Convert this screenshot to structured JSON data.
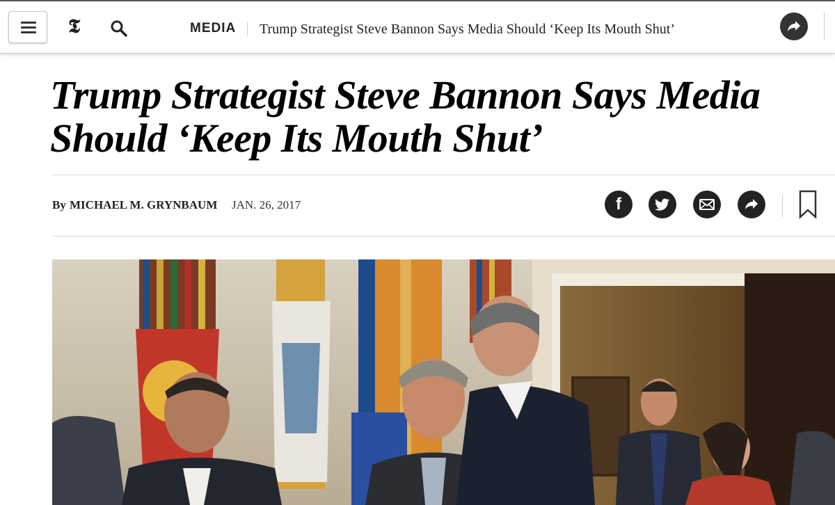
{
  "header": {
    "logo": "𝕿",
    "section": "MEDIA",
    "headline": "Trump Strategist Steve Bannon Says Media Should ‘Keep Its Mouth Shut’",
    "icons": [
      "menu-icon",
      "search-icon",
      "share-arrow-icon"
    ]
  },
  "article": {
    "headline_line1": "Trump Strategist Steve Bannon Says Media",
    "headline_line2": "Should ‘Keep Its Mouth Shut’",
    "byline_prefix": "By",
    "author": "MICHAEL M. GRYNBAUM",
    "date": "JAN. 26, 2017"
  },
  "share_buttons": [
    {
      "name": "facebook",
      "glyph": "f"
    },
    {
      "name": "twitter",
      "glyph": ""
    },
    {
      "name": "email",
      "glyph": ""
    },
    {
      "name": "share",
      "glyph": ""
    }
  ],
  "colors": {
    "text": "#000000",
    "button_dark": "#222222",
    "rule": "#d6d6d6"
  },
  "photo": {
    "icon": "article-photo"
  }
}
